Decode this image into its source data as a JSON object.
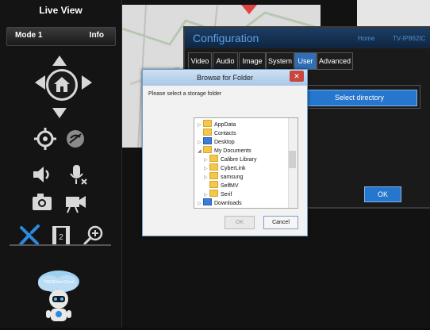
{
  "sidebar": {
    "title": "Live View",
    "mode_label": "Mode 1",
    "info_label": "Info",
    "icons": [
      "arrow-up-icon",
      "arrow-down-icon",
      "arrow-left-icon",
      "arrow-right-icon",
      "home-icon",
      "focus-icon",
      "auto-focus-icon",
      "volume-icon",
      "microphone-mute-icon",
      "snapshot-icon",
      "record-icon",
      "settings-icon",
      "playback-icon",
      "zoom-icon",
      "mascot-icon"
    ],
    "mascot_badge": "TRENDnet Cloud"
  },
  "config": {
    "title": "Configuration",
    "right_text_1": "Home",
    "right_text_2": "TV-IP862IC",
    "tabs": [
      "Video",
      "Audio",
      "Image",
      "System",
      "User",
      "Advanced"
    ],
    "active_tab": "User",
    "select_directory_label": "Select directory",
    "ok_label": "OK"
  },
  "browse": {
    "title": "Browse for Folder",
    "prompt": "Please select a storage folder",
    "tree": [
      "AppData",
      "Contacts",
      "Desktop",
      "My Documents",
      "Calibre Library",
      "CyberLink",
      "samsung",
      "SelfMV",
      "Serif",
      "Downloads"
    ],
    "ok_label": "OK",
    "cancel_label": "Cancel",
    "close_label": "✕"
  },
  "colors": {
    "accent_blue": "#2576cc",
    "title_blue": "#5aa2e8",
    "panel_dark": "#141414",
    "icon_blue": "#2b8ae0"
  }
}
